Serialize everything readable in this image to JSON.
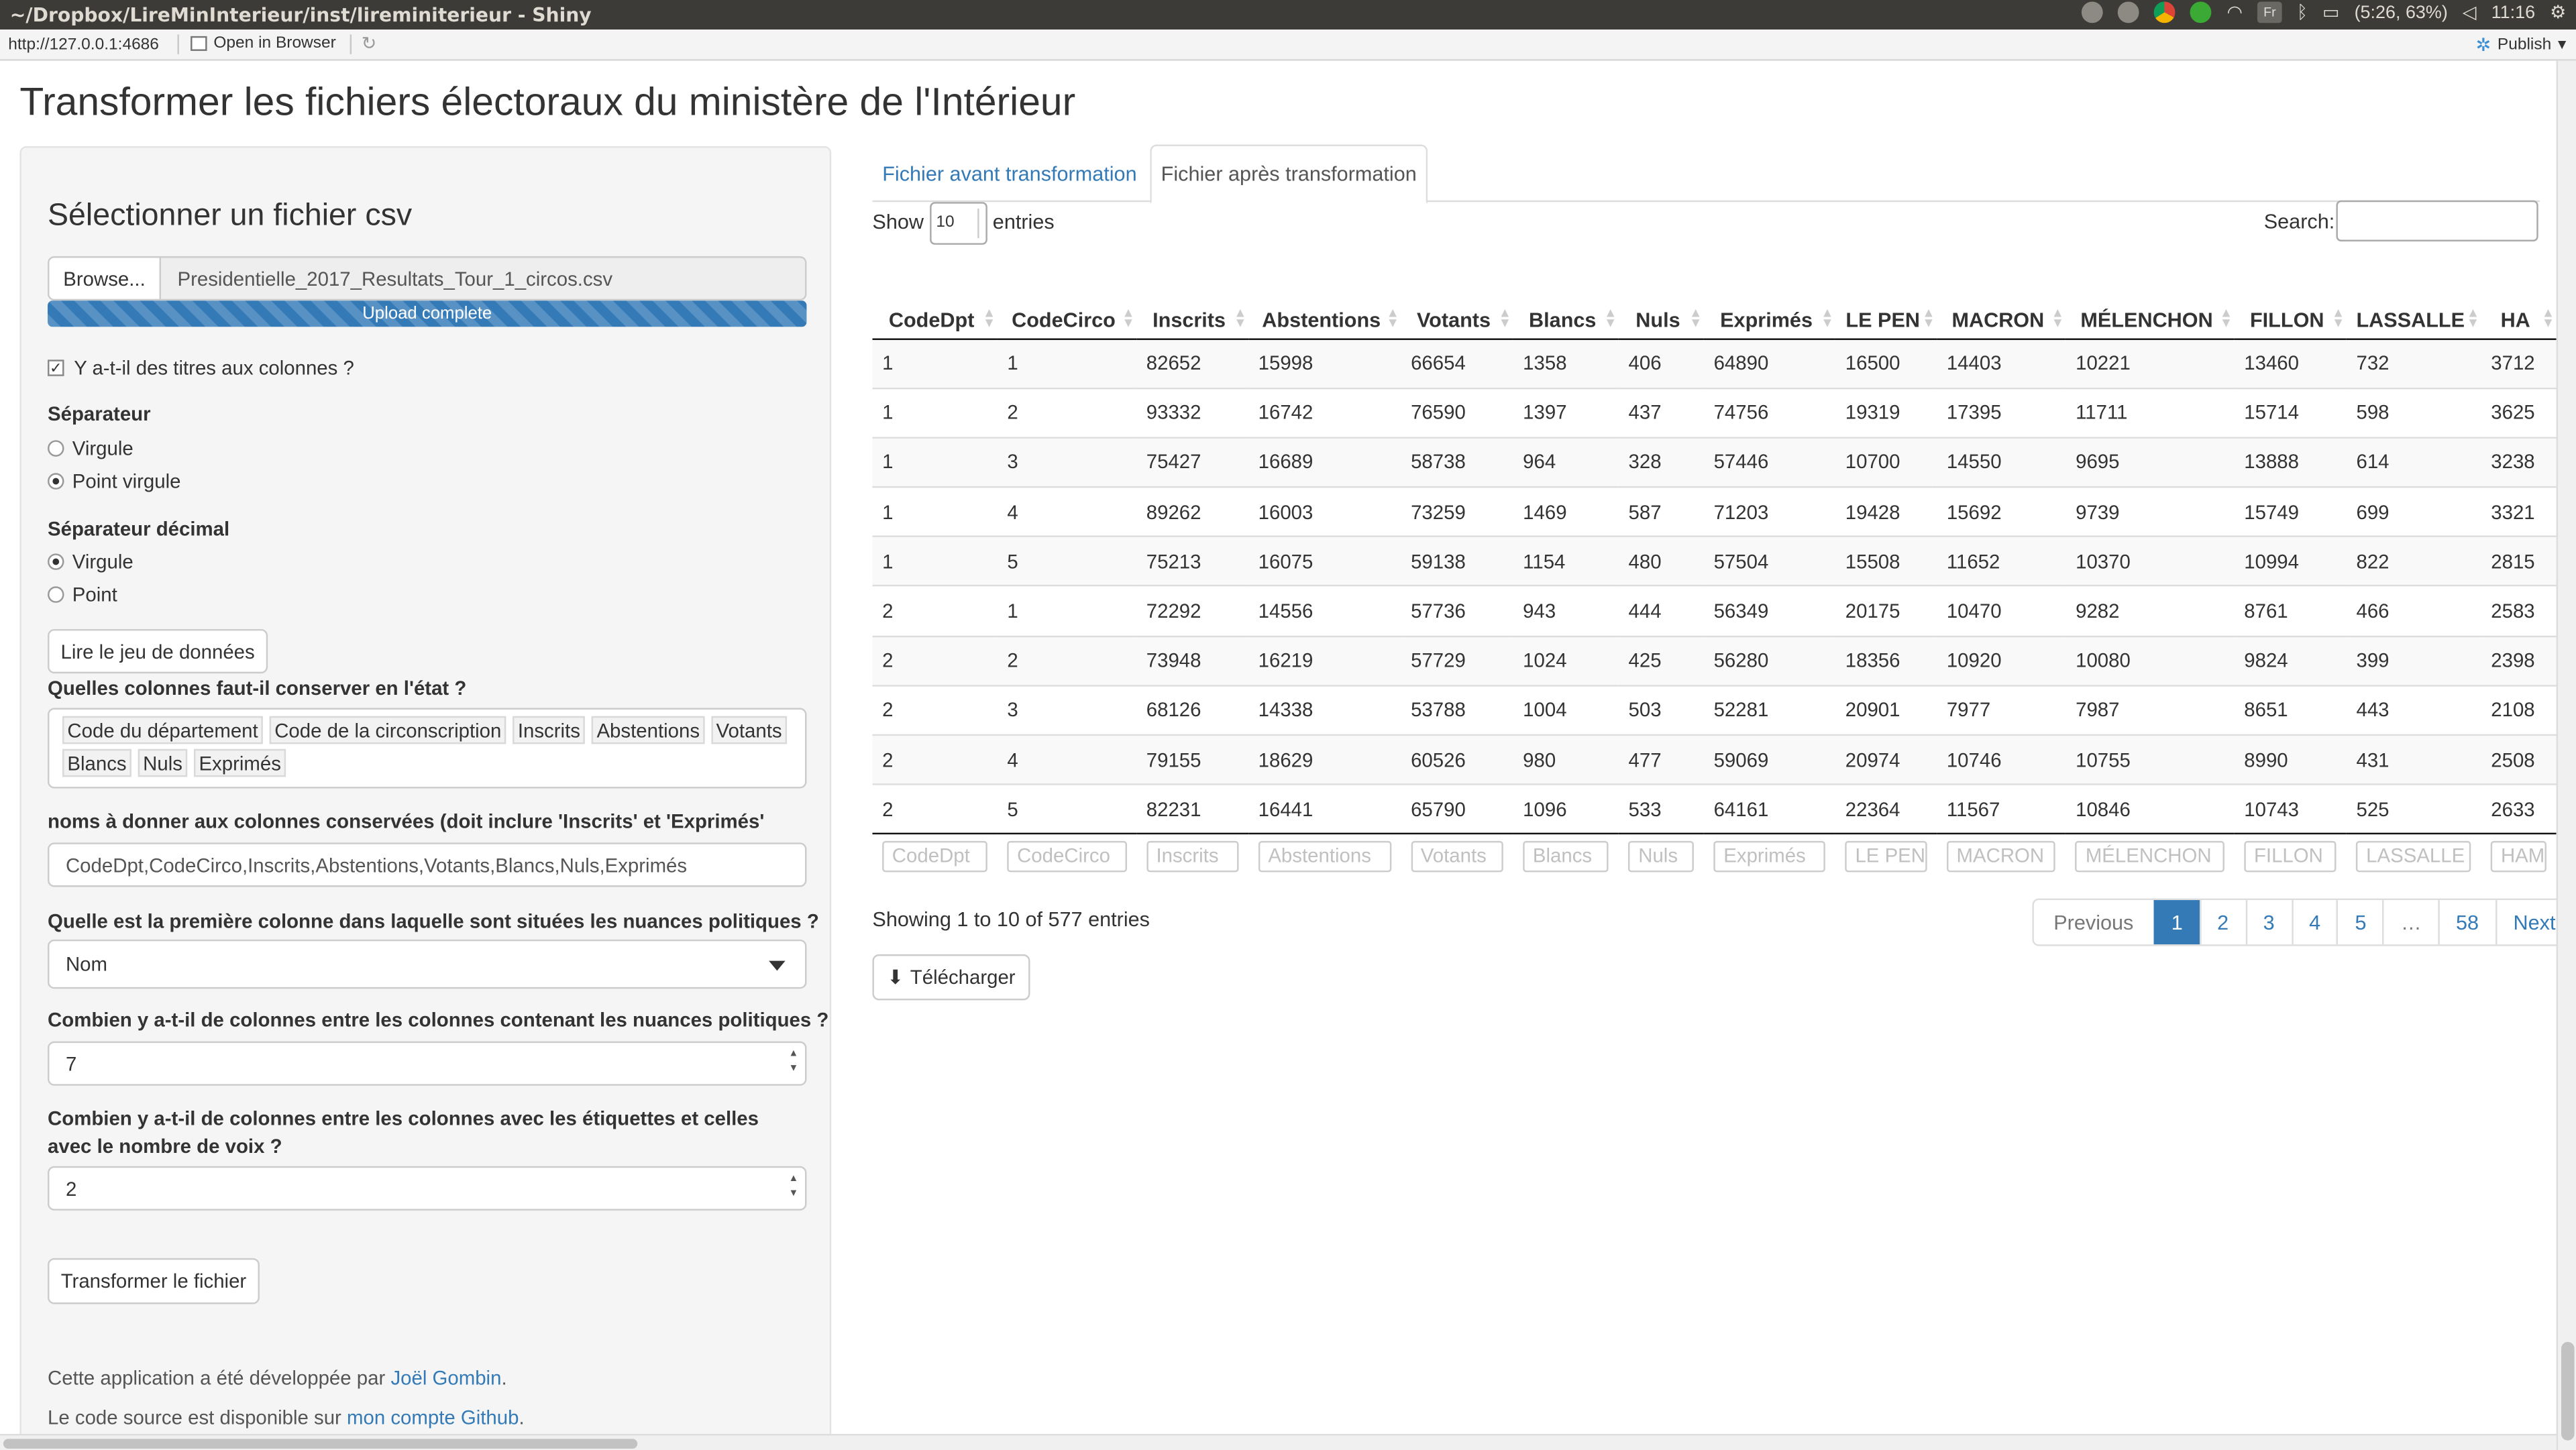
{
  "os": {
    "window_title": "~/Dropbox/LireMinInterieur/inst/lireminiterieur - Shiny",
    "battery": "(5:26, 63%)",
    "clock": "11:16",
    "lang_indicator": "Fr"
  },
  "toolbar": {
    "url": "http://127.0.0.1:4686",
    "open_in_browser": "Open in Browser",
    "publish": "Publish"
  },
  "page": {
    "title": "Transformer les fichiers électoraux du ministère de l'Intérieur"
  },
  "sidebar": {
    "title": "Sélectionner un fichier csv",
    "browse_label": "Browse...",
    "file_name": "Presidentielle_2017_Resultats_Tour_1_circos.csv",
    "upload_status": "Upload complete",
    "header_checkbox_label": "Y a-t-il des titres aux colonnes ?",
    "header_checked": "✓",
    "separator_label": "Séparateur",
    "separator_options": [
      "Virgule",
      "Point virgule"
    ],
    "separator_selected": "Point virgule",
    "decimal_label": "Séparateur décimal",
    "decimal_options": [
      "Virgule",
      "Point"
    ],
    "decimal_selected": "Virgule",
    "read_button": "Lire le jeu de données",
    "keep_cols_label": "Quelles colonnes faut-il conserver en l'état ?",
    "keep_cols_tags": [
      "Code du département",
      "Code de la circonscription",
      "Inscrits",
      "Abstentions",
      "Votants",
      "Blancs",
      "Nuls",
      "Exprimés"
    ],
    "names_label": "noms à donner aux colonnes conservées (doit inclure 'Inscrits' et 'Exprimés'",
    "names_value": "CodeDpt,CodeCirco,Inscrits,Abstentions,Votants,Blancs,Nuls,Exprimés",
    "first_col_label": "Quelle est la première colonne dans laquelle sont situées les nuances politiques ?",
    "first_col_value": "Nom",
    "between_nuances_label": "Combien y a-t-il de colonnes entre les colonnes contenant les nuances politiques ?",
    "between_nuances_value": "7",
    "between_labels_label": "Combien y a-t-il de colonnes entre les colonnes avec les étiquettes et celles avec le nombre de voix ?",
    "between_labels_value": "2",
    "transform_button": "Transformer le fichier",
    "footer1_text": "Cette application a été développée par ",
    "footer1_link": "Joël Gombin",
    "footer1_end": ".",
    "footer2_text": "Le code source est disponible sur ",
    "footer2_link": "mon compte Github",
    "footer2_end": "."
  },
  "tabs": [
    "Fichier avant transformation",
    "Fichier après transformation"
  ],
  "active_tab": "Fichier après transformation",
  "datatable": {
    "show_label": "Show",
    "length_value": "10",
    "entries_label": "entries",
    "search_label": "Search:",
    "columns": [
      "CodeDpt",
      "CodeCirco",
      "Inscrits",
      "Abstentions",
      "Votants",
      "Blancs",
      "Nuls",
      "Exprimés",
      "LE PEN",
      "MACRON",
      "MÉLENCHON",
      "FILLON",
      "LASSALLE",
      "HA"
    ],
    "filter_placeholders": [
      "CodeDpt",
      "CodeCirco",
      "Inscrits",
      "Abstentions",
      "Votants",
      "Blancs",
      "Nuls",
      "Exprimés",
      "LE PEN",
      "MACRON",
      "MÉLENCHON",
      "FILLON",
      "LASSALLE",
      "HAM"
    ],
    "rows": [
      [
        "1",
        "1",
        "82652",
        "15998",
        "66654",
        "1358",
        "406",
        "64890",
        "16500",
        "14403",
        "10221",
        "13460",
        "732",
        "3712"
      ],
      [
        "1",
        "2",
        "93332",
        "16742",
        "76590",
        "1397",
        "437",
        "74756",
        "19319",
        "17395",
        "11711",
        "15714",
        "598",
        "3625"
      ],
      [
        "1",
        "3",
        "75427",
        "16689",
        "58738",
        "964",
        "328",
        "57446",
        "10700",
        "14550",
        "9695",
        "13888",
        "614",
        "3238"
      ],
      [
        "1",
        "4",
        "89262",
        "16003",
        "73259",
        "1469",
        "587",
        "71203",
        "19428",
        "15692",
        "9739",
        "15749",
        "699",
        "3321"
      ],
      [
        "1",
        "5",
        "75213",
        "16075",
        "59138",
        "1154",
        "480",
        "57504",
        "15508",
        "11652",
        "10370",
        "10994",
        "822",
        "2815"
      ],
      [
        "2",
        "1",
        "72292",
        "14556",
        "57736",
        "943",
        "444",
        "56349",
        "20175",
        "10470",
        "9282",
        "8761",
        "466",
        "2583"
      ],
      [
        "2",
        "2",
        "73948",
        "16219",
        "57729",
        "1024",
        "425",
        "56280",
        "18356",
        "10920",
        "10080",
        "9824",
        "399",
        "2398"
      ],
      [
        "2",
        "3",
        "68126",
        "14338",
        "53788",
        "1004",
        "503",
        "52281",
        "20901",
        "7977",
        "7987",
        "8651",
        "443",
        "2108"
      ],
      [
        "2",
        "4",
        "79155",
        "18629",
        "60526",
        "980",
        "477",
        "59069",
        "20974",
        "10746",
        "10755",
        "8990",
        "431",
        "2508"
      ],
      [
        "2",
        "5",
        "82231",
        "16441",
        "65790",
        "1096",
        "533",
        "64161",
        "22364",
        "11567",
        "10846",
        "10743",
        "525",
        "2633"
      ]
    ],
    "info": "Showing 1 to 10 of 577 entries",
    "pagination": [
      "Previous",
      "1",
      "2",
      "3",
      "4",
      "5",
      "…",
      "58",
      "Next"
    ],
    "active_page": "1",
    "download_button": "Télécharger"
  }
}
